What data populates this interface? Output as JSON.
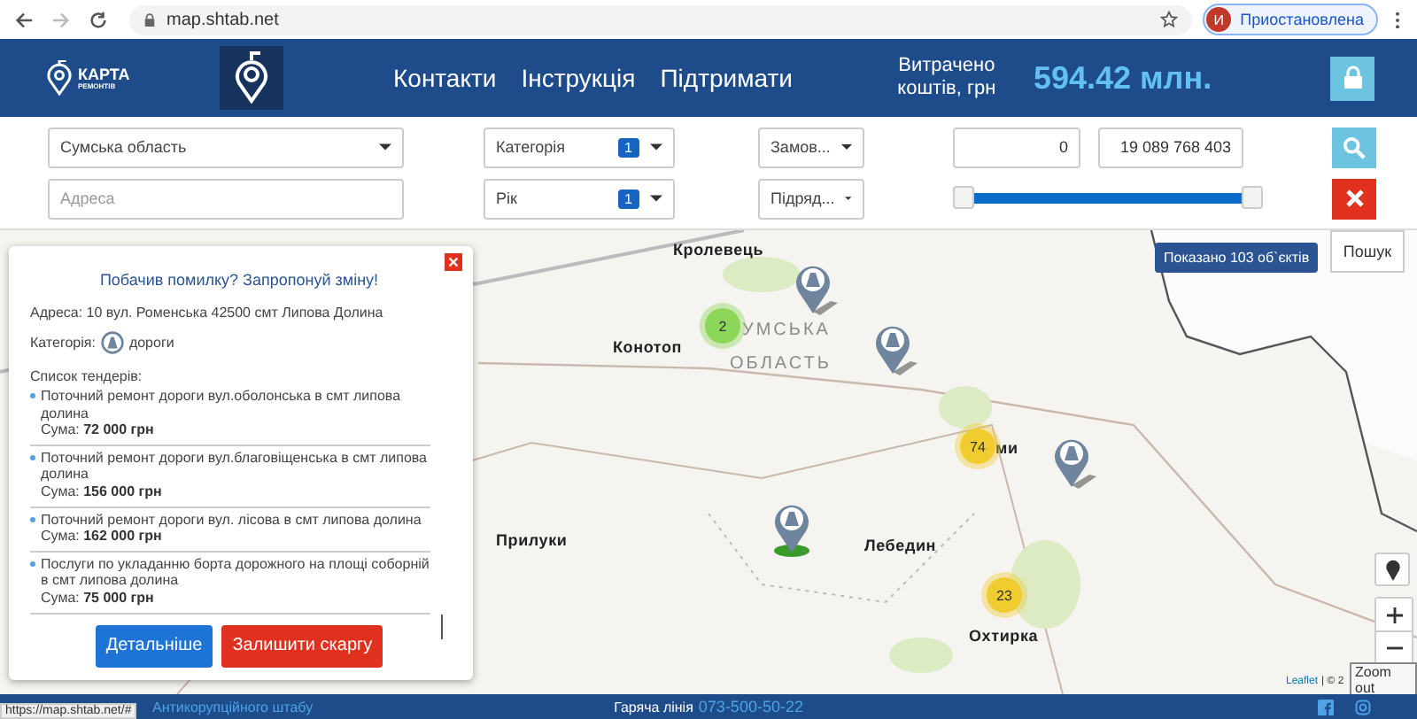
{
  "browser": {
    "url": "map.shtab.net",
    "profile_initial": "И",
    "profile_label": "Приостановлена"
  },
  "header": {
    "logo_title": "КАРТА",
    "logo_subtitle": "РЕМОНТІВ",
    "nav": [
      "Контакти",
      "Інструкція",
      "Підтримати"
    ],
    "spent_label": "Витрачено коштів, грн",
    "spent_value": "594.42 млн."
  },
  "filters": {
    "region": "Сумська область",
    "address_placeholder": "Адреса",
    "category": {
      "label": "Категорія",
      "count": "1"
    },
    "year": {
      "label": "Рік",
      "count": "1"
    },
    "customer": "Замов...",
    "contractor": "Підряд...",
    "min": "0",
    "max": "19 089 768 403",
    "slider": {
      "level": 1
    }
  },
  "map": {
    "shown_badge": "Показано 103 об`єктів",
    "search_tab": "Пошук",
    "labels": [
      {
        "text": "Кролевець",
        "kind": "city"
      },
      {
        "text": "Конотоп",
        "kind": "city"
      },
      {
        "text": "УМСЬКА",
        "kind": "region"
      },
      {
        "text": "ОБЛАСТЬ",
        "kind": "region"
      },
      {
        "text": "ми",
        "kind": "city"
      },
      {
        "text": "Прилуки",
        "kind": "city"
      },
      {
        "text": "Лебедин",
        "kind": "city"
      },
      {
        "text": "Охтирка",
        "kind": "city"
      }
    ],
    "clusters": [
      {
        "count": "2",
        "color": "#8cd65a"
      },
      {
        "count": "74",
        "color": "#f0cc30"
      },
      {
        "count": "23",
        "color": "#f0cc30"
      }
    ],
    "markers": [
      {
        "selected": false
      },
      {
        "selected": false
      },
      {
        "selected": false
      },
      {
        "selected": true
      }
    ],
    "zoom_tooltip": "Zoom out",
    "attribution": "Leaflet",
    "attribution_rest": "| © 2"
  },
  "popup": {
    "title": "Побачив помилку? Запропонуй зміну!",
    "address": "Адреса: 10 вул. Роменська 42500 смт Липова Долина",
    "category_label": "Категорія:",
    "category": "дороги",
    "tenders_label": "Список тендерів:",
    "tenders": [
      {
        "name": "Поточний ремонт дороги вул.оболонська в смт липова долина",
        "sum_label": "Сума:",
        "sum": "72 000 грн"
      },
      {
        "name": "Поточний ремонт дороги вул.благовіщенська в смт липова долина",
        "sum_label": "Сума:",
        "sum": "156 000 грн"
      },
      {
        "name": "Поточний ремонт дороги вул. лісова в смт липова долина",
        "sum_label": "Сума:",
        "sum": "162 000 грн"
      },
      {
        "name": "Послуги по укладанню борта дорожного на площі соборній в смт липова долина",
        "sum_label": "Сума:",
        "sum": "75 000 грн"
      }
    ],
    "buttons": [
      "Детальніше",
      "Залишити скаргу"
    ]
  },
  "footer": {
    "hotline_label": "Гаряча лінія",
    "hotline": "073-500-50-22",
    "org": "Антикорупційного штабу"
  },
  "status_url": "https://map.shtab.net/#"
}
